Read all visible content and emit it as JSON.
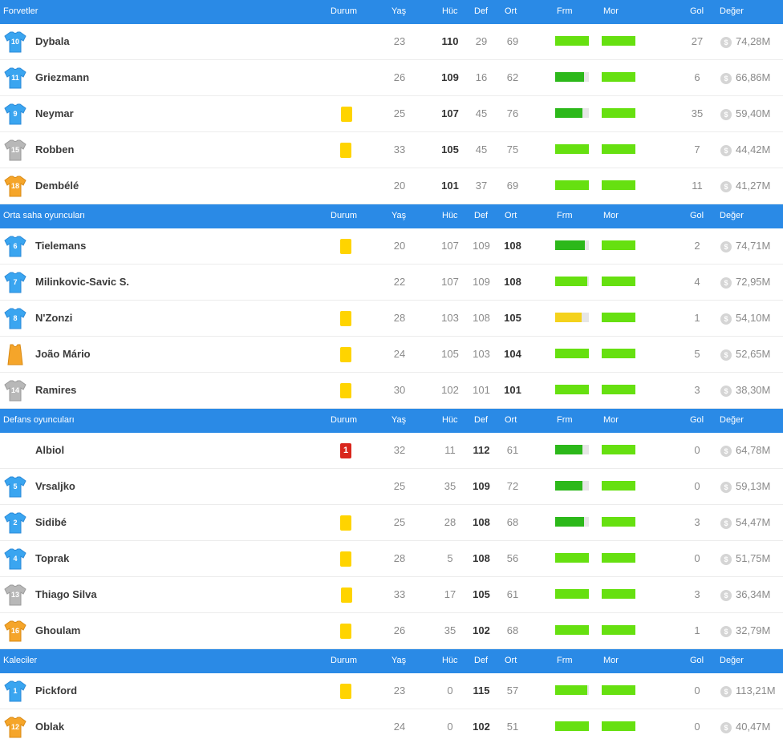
{
  "columns": {
    "status": "Durum",
    "age": "Yaş",
    "att": "Hüc",
    "def": "Def",
    "ovr": "Ort",
    "form": "Frm",
    "morale": "Mor",
    "goals": "Gol",
    "value": "Değer"
  },
  "colors": {
    "header": "#2a8ae6",
    "bar_green": "#66e010",
    "bar_dark_green": "#2cb81a",
    "bar_yellow": "#f4d21c",
    "jersey_blue": "#3aa5f0",
    "jersey_grey": "#b8b8b8",
    "jersey_orange": "#f5a52a",
    "card_yellow": "#ffd400",
    "card_red": "#d9261c"
  },
  "coin_symbol": "$",
  "sections": [
    {
      "title": "Forvetler",
      "players": [
        {
          "jersey": "10",
          "jersey_color": "blue",
          "name": "Dybala",
          "card": "",
          "age": "23",
          "att": "110",
          "def": "29",
          "ovr": "69",
          "bold": "att",
          "form": 1.0,
          "form_color": "green",
          "morale": 1.0,
          "goals": "27",
          "value": "74,28M"
        },
        {
          "jersey": "11",
          "jersey_color": "blue",
          "name": "Griezmann",
          "card": "",
          "age": "26",
          "att": "109",
          "def": "16",
          "ovr": "62",
          "bold": "att",
          "form": 0.85,
          "form_color": "dark",
          "morale": 1.0,
          "goals": "6",
          "value": "66,86M"
        },
        {
          "jersey": "9",
          "jersey_color": "blue",
          "name": "Neymar",
          "card": "double",
          "age": "25",
          "att": "107",
          "def": "45",
          "ovr": "76",
          "bold": "att",
          "form": 0.8,
          "form_color": "dark",
          "morale": 1.0,
          "goals": "35",
          "value": "59,40M"
        },
        {
          "jersey": "15",
          "jersey_color": "grey",
          "name": "Robben",
          "card": "yellow",
          "age": "33",
          "att": "105",
          "def": "45",
          "ovr": "75",
          "bold": "att",
          "form": 1.0,
          "form_color": "green",
          "morale": 1.0,
          "goals": "7",
          "value": "44,42M"
        },
        {
          "jersey": "18",
          "jersey_color": "orange",
          "name": "Dembélé",
          "card": "",
          "age": "20",
          "att": "101",
          "def": "37",
          "ovr": "69",
          "bold": "att",
          "form": 1.0,
          "form_color": "green",
          "morale": 1.0,
          "goals": "11",
          "value": "41,27M"
        }
      ]
    },
    {
      "title": "Orta saha oyuncuları",
      "players": [
        {
          "jersey": "6",
          "jersey_color": "blue",
          "name": "Tielemans",
          "card": "yellow",
          "age": "20",
          "att": "107",
          "def": "109",
          "ovr": "108",
          "bold": "ovr",
          "form": 0.88,
          "form_color": "dark",
          "morale": 1.0,
          "goals": "2",
          "value": "74,71M"
        },
        {
          "jersey": "7",
          "jersey_color": "blue",
          "name": "Milinkovic-Savic S.",
          "card": "",
          "age": "22",
          "att": "107",
          "def": "109",
          "ovr": "108",
          "bold": "ovr",
          "form": 0.95,
          "form_color": "green",
          "morale": 1.0,
          "goals": "4",
          "value": "72,95M"
        },
        {
          "jersey": "8",
          "jersey_color": "blue",
          "name": "N'Zonzi",
          "card": "yellow",
          "age": "28",
          "att": "103",
          "def": "108",
          "ovr": "105",
          "bold": "ovr",
          "form": 0.78,
          "form_color": "yellow",
          "morale": 1.0,
          "goals": "1",
          "value": "54,10M"
        },
        {
          "jersey": "",
          "jersey_color": "orange-vest",
          "name": "João Mário",
          "card": "yellow",
          "age": "24",
          "att": "105",
          "def": "103",
          "ovr": "104",
          "bold": "ovr",
          "form": 1.0,
          "form_color": "green",
          "morale": 1.0,
          "goals": "5",
          "value": "52,65M"
        },
        {
          "jersey": "14",
          "jersey_color": "grey",
          "name": "Ramires",
          "card": "yellow",
          "age": "30",
          "att": "102",
          "def": "101",
          "ovr": "101",
          "bold": "ovr",
          "form": 1.0,
          "form_color": "green",
          "morale": 1.0,
          "goals": "3",
          "value": "38,30M"
        }
      ]
    },
    {
      "title": "Defans oyuncuları",
      "players": [
        {
          "jersey": "",
          "jersey_color": "none",
          "name": "Albiol",
          "card": "red",
          "card_text": "1",
          "age": "32",
          "att": "11",
          "def": "112",
          "ovr": "61",
          "bold": "def",
          "form": 0.82,
          "form_color": "dark",
          "morale": 1.0,
          "goals": "0",
          "value": "64,78M"
        },
        {
          "jersey": "5",
          "jersey_color": "blue",
          "name": "Vrsaljko",
          "card": "",
          "age": "25",
          "att": "35",
          "def": "109",
          "ovr": "72",
          "bold": "def",
          "form": 0.82,
          "form_color": "dark",
          "morale": 1.0,
          "goals": "0",
          "value": "59,13M"
        },
        {
          "jersey": "2",
          "jersey_color": "blue",
          "name": "Sidibé",
          "card": "yellow",
          "age": "25",
          "att": "28",
          "def": "108",
          "ovr": "68",
          "bold": "def",
          "form": 0.85,
          "form_color": "dark",
          "morale": 1.0,
          "goals": "3",
          "value": "54,47M"
        },
        {
          "jersey": "4",
          "jersey_color": "blue",
          "name": "Toprak",
          "card": "yellow",
          "age": "28",
          "att": "5",
          "def": "108",
          "ovr": "56",
          "bold": "def",
          "form": 1.0,
          "form_color": "green",
          "morale": 1.0,
          "goals": "0",
          "value": "51,75M"
        },
        {
          "jersey": "13",
          "jersey_color": "grey",
          "name": "Thiago Silva",
          "card": "double",
          "age": "33",
          "att": "17",
          "def": "105",
          "ovr": "61",
          "bold": "def",
          "form": 1.0,
          "form_color": "green",
          "morale": 1.0,
          "goals": "3",
          "value": "36,34M"
        },
        {
          "jersey": "16",
          "jersey_color": "orange",
          "name": "Ghoulam",
          "card": "yellow",
          "age": "26",
          "att": "35",
          "def": "102",
          "ovr": "68",
          "bold": "def",
          "form": 1.0,
          "form_color": "green",
          "morale": 1.0,
          "goals": "1",
          "value": "32,79M"
        }
      ]
    },
    {
      "title": "Kaleciler",
      "players": [
        {
          "jersey": "1",
          "jersey_color": "blue",
          "name": "Pickford",
          "card": "yellow",
          "age": "23",
          "att": "0",
          "def": "115",
          "ovr": "57",
          "bold": "def",
          "form": 0.95,
          "form_color": "green",
          "morale": 1.0,
          "goals": "0",
          "value": "113,21M"
        },
        {
          "jersey": "12",
          "jersey_color": "orange",
          "name": "Oblak",
          "card": "",
          "age": "24",
          "att": "0",
          "def": "102",
          "ovr": "51",
          "bold": "def",
          "form": 1.0,
          "form_color": "green",
          "morale": 1.0,
          "goals": "0",
          "value": "40,47M"
        }
      ]
    }
  ]
}
